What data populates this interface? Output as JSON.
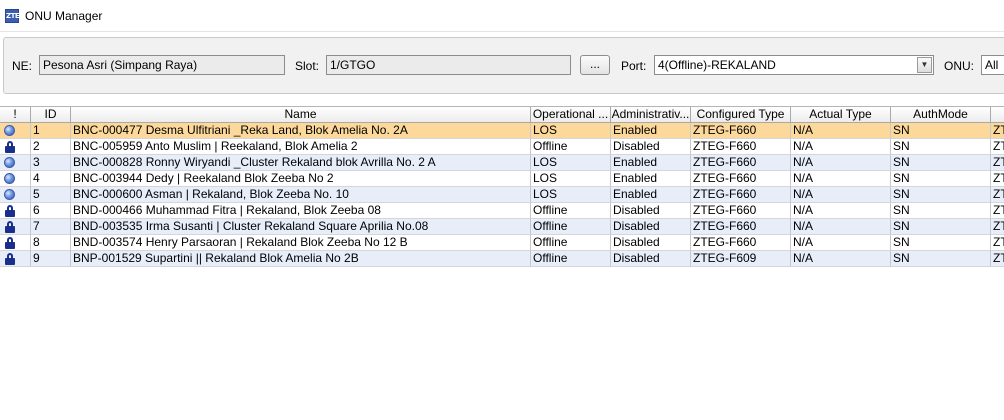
{
  "window": {
    "title": "ONU Manager",
    "icon": "zte-app-icon"
  },
  "filters": {
    "ne_label": "NE:",
    "ne_value": "Pesona Asri (Simpang Raya)",
    "slot_label": "Slot:",
    "slot_value": "1/GTGO",
    "browse_label": "...",
    "port_label": "Port:",
    "port_value": "4(Offline)-REKALAND",
    "onu_label": "ONU:",
    "onu_value": "All"
  },
  "colors": {
    "selected_row": "#fcd99a",
    "alt_row": "#e7eefa",
    "row": "#ffffff",
    "panel": "#f1f1f1"
  },
  "table": {
    "columns": [
      "!",
      "ID",
      "Name",
      "Operational ...",
      "Administrativ...",
      "Configured Type",
      "Actual Type",
      "AuthMode",
      ""
    ],
    "rows": [
      {
        "icon": "globe-icon",
        "cells": [
          "1",
          "BNC-000477 Desma Ulfitriani _Reka Land, Blok Amelia No. 2A",
          "LOS",
          "Enabled",
          "ZTEG-F660",
          "N/A",
          "SN",
          "ZT"
        ]
      },
      {
        "icon": "lock-icon",
        "cells": [
          "2",
          "BNC-005959 Anto Muslim  | Reekaland, Blok Amelia 2",
          "Offline",
          "Disabled",
          "ZTEG-F660",
          "N/A",
          "SN",
          "ZT"
        ]
      },
      {
        "icon": "globe-icon",
        "cells": [
          "3",
          "BNC-000828 Ronny Wiryandi _Cluster Rekaland blok Avrilla No. 2 A",
          "LOS",
          "Enabled",
          "ZTEG-F660",
          "N/A",
          "SN",
          "ZT"
        ]
      },
      {
        "icon": "globe-icon",
        "cells": [
          "4",
          "BNC-003944 Dedy | Reekaland Blok Zeeba No 2",
          "LOS",
          "Enabled",
          "ZTEG-F660",
          "N/A",
          "SN",
          "ZT"
        ]
      },
      {
        "icon": "globe-icon",
        "cells": [
          "5",
          "BNC-000600 Asman | Rekaland, Blok Zeeba No. 10",
          "LOS",
          "Enabled",
          "ZTEG-F660",
          "N/A",
          "SN",
          "ZT"
        ]
      },
      {
        "icon": "lock-icon",
        "cells": [
          "6",
          "BND-000466 Muhammad Fitra | Rekaland, Blok Zeeba 08",
          "Offline",
          "Disabled",
          "ZTEG-F660",
          "N/A",
          "SN",
          "ZT"
        ]
      },
      {
        "icon": "lock-icon",
        "cells": [
          "7",
          "BND-003535 Irma Susanti | Cluster Rekaland Square Aprilia No.08",
          "Offline",
          "Disabled",
          "ZTEG-F660",
          "N/A",
          "SN",
          "ZT"
        ]
      },
      {
        "icon": "lock-icon",
        "cells": [
          "8",
          "BND-003574 Henry Parsaoran | Rekaland Blok Zeeba No 12 B",
          "Offline",
          "Disabled",
          "ZTEG-F660",
          "N/A",
          "SN",
          "ZT"
        ]
      },
      {
        "icon": "lock-icon",
        "cells": [
          "9",
          "BNP-001529 Supartini || Rekaland Blok Amelia No 2B",
          "Offline",
          "Disabled",
          "ZTEG-F609",
          "N/A",
          "SN",
          "ZT"
        ]
      }
    ]
  }
}
